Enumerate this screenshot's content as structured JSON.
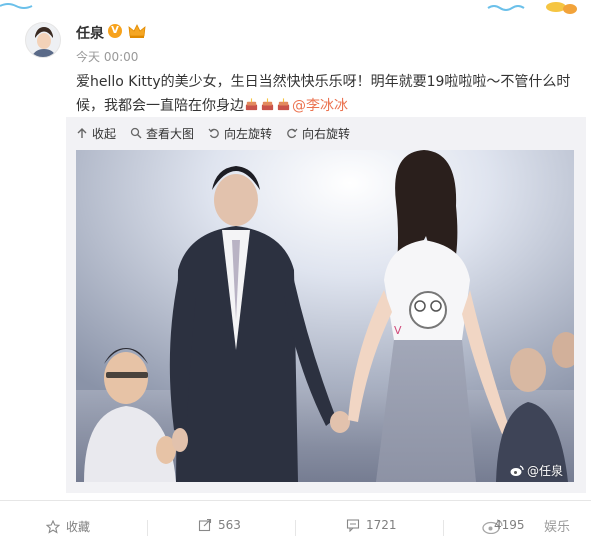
{
  "post": {
    "username": "任泉",
    "verified_badge": "V",
    "time": "今天 00:00",
    "text_line1": "爱hello Kitty的美少女，生日当然快快乐乐呀！明年就要19啦啦啦～不管什么时",
    "text_line2": "候，我都会一直陪在你身边",
    "mention": "@李冰冰",
    "inline_icons": [
      "cake-icon",
      "cake-icon",
      "cake-icon"
    ]
  },
  "media_toolbar": {
    "collapse": "收起",
    "view_large": "查看大图",
    "rotate_left": "向左旋转",
    "rotate_right": "向右旋转"
  },
  "photo": {
    "watermark": "@任泉"
  },
  "actions": {
    "favorite": "收藏",
    "repost_count": "563",
    "comment_count": "1721",
    "like_count": "4195"
  },
  "corner_watermark": "娱乐",
  "colors": {
    "mention": "#eb7350",
    "badge": "#f7a21c",
    "muted": "#999999"
  }
}
